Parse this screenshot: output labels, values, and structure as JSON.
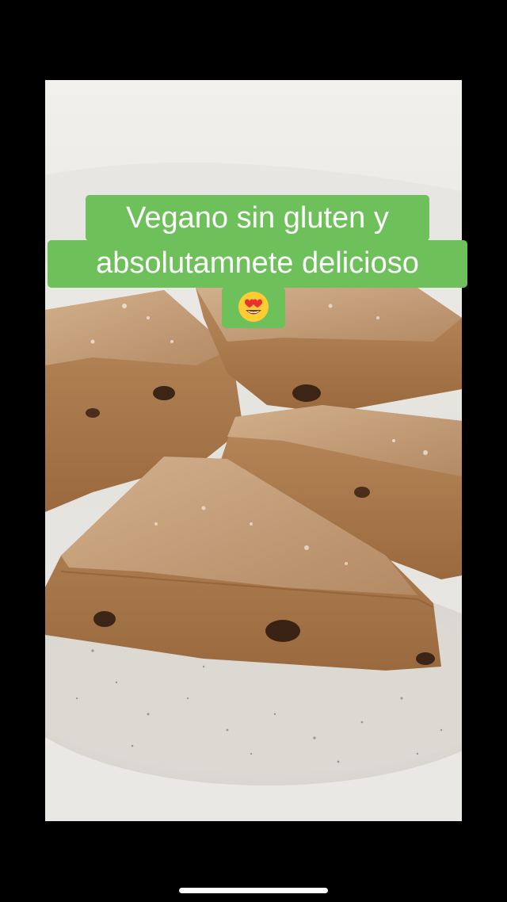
{
  "caption": {
    "line1": "Vegano sin gluten y",
    "line2": "absolutamnete delicioso",
    "emoji_icon": "heart-eyes-emoji",
    "background_color": "#6ec05a",
    "text_color": "#ffffff"
  },
  "photo": {
    "subject": "vegan gluten-free scones on a speckled plate"
  }
}
